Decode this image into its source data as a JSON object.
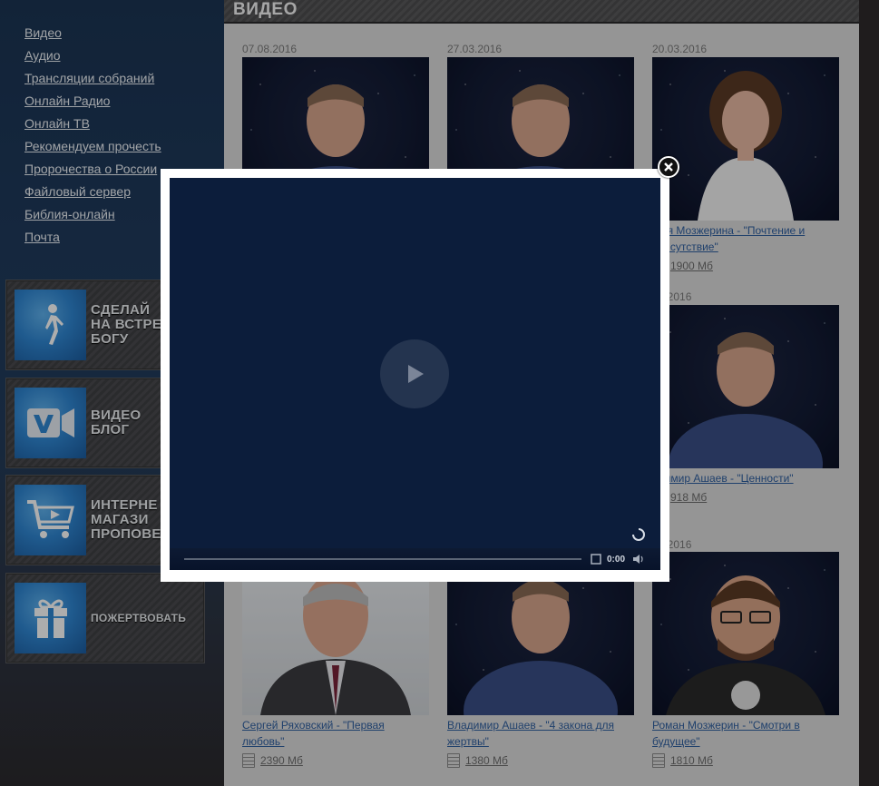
{
  "nav": {
    "items": [
      {
        "label": "Видео"
      },
      {
        "label": "Аудио"
      },
      {
        "label": "Трансляции собраний"
      },
      {
        "label": "Онлайн Радио"
      },
      {
        "label": "Онлайн ТВ"
      },
      {
        "label": "Рекомендуем прочесть"
      },
      {
        "label": "Пророчества о России"
      },
      {
        "label": "Файловый сервер"
      },
      {
        "label": "Библия-онлайн"
      },
      {
        "label": "Почта"
      }
    ]
  },
  "promos": [
    {
      "label": "СДЕЛАЙ\nНА ВСТРЕ\nБОГУ",
      "icon": "walking-person-icon"
    },
    {
      "label": "ВИДЕО\nБЛОГ",
      "icon": "video-camera-icon"
    },
    {
      "label": "ИНТЕРНЕ\nМАГАЗИ\nПРОПОВЕ",
      "icon": "shopping-cart-icon"
    },
    {
      "label": "ПОЖЕРТВОВАТЬ",
      "icon": "gift-icon"
    }
  ],
  "section": {
    "title": "ВИДЕО"
  },
  "videos": [
    {
      "date": "07.08.2016",
      "title": "",
      "size": ""
    },
    {
      "date": "27.03.2016",
      "title": "",
      "size": ""
    },
    {
      "date": "20.03.2016",
      "title": "фия Мозжерина - \"Почтение и\n присутствие\"",
      "size": "1900 Мб"
    },
    {
      "date": "02.2016",
      "title": "адимир Ашаев - \"Ценности\"",
      "size": "918 Мб"
    },
    {
      "date": "01.2016",
      "title": "",
      "size": ""
    },
    {
      "date": "",
      "title": "Сергей Ряховский - \"Первая любовь\"",
      "size": "2390 Мб"
    },
    {
      "date": "",
      "title": "Владимир Ашаев - \"4 закона для\nжертвы\"",
      "size": "1380 Мб"
    },
    {
      "date": "",
      "title": "Роман Мозжерин - \"Смотри в\nбудущее\"",
      "size": "1810 Мб"
    }
  ],
  "player": {
    "time": "0:00"
  },
  "colors": {
    "player_bg": "#0c1d3b",
    "link": "#2f5fa0",
    "main_bg": "#dcdcdc"
  }
}
